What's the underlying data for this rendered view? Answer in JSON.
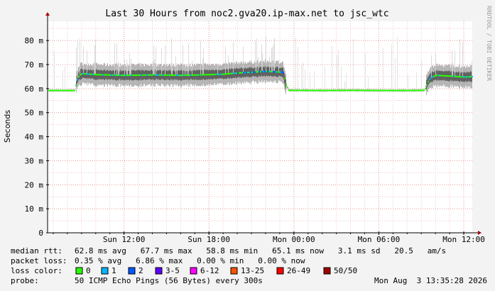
{
  "chart_data": {
    "type": "area",
    "title": "Last 30 Hours from noc2.gva20.ip-max.net to jsc_wtc",
    "ylabel": "Seconds",
    "watermark": "RRDTOOL / TOBI OETIKER",
    "ylim": [
      0,
      0.088
    ],
    "yticks": [
      {
        "value": 0,
        "label": "0"
      },
      {
        "value": 0.01,
        "label": "10 m"
      },
      {
        "value": 0.02,
        "label": "20 m"
      },
      {
        "value": 0.03,
        "label": "30 m"
      },
      {
        "value": 0.04,
        "label": "40 m"
      },
      {
        "value": 0.05,
        "label": "50 m"
      },
      {
        "value": 0.06,
        "label": "60 m"
      },
      {
        "value": 0.07,
        "label": "70 m"
      },
      {
        "value": 0.08,
        "label": "80 m"
      }
    ],
    "xlim_hours": [
      6.6,
      36.6
    ],
    "xticks": [
      {
        "hour": 12,
        "label": "Sun 12:00"
      },
      {
        "hour": 18,
        "label": "Sun 18:00"
      },
      {
        "hour": 24,
        "label": "Mon 00:00"
      },
      {
        "hour": 30,
        "label": "Mon 06:00"
      },
      {
        "hour": 36,
        "label": "Mon 12:00"
      }
    ],
    "median_series": {
      "name": "median rtt",
      "x_hours": [
        6.6,
        8.5,
        8.6,
        8.8,
        9.0,
        10,
        12,
        14,
        16,
        18,
        19,
        20,
        21,
        22,
        22.5,
        23.2,
        23.4,
        23.6,
        26,
        28,
        30,
        32,
        33.2,
        33.4,
        33.6,
        34,
        35,
        36,
        36.6
      ],
      "values": [
        0.0592,
        0.0592,
        0.063,
        0.0655,
        0.0662,
        0.0658,
        0.0655,
        0.0657,
        0.0655,
        0.0658,
        0.066,
        0.0665,
        0.0668,
        0.0672,
        0.067,
        0.0668,
        0.062,
        0.0593,
        0.0592,
        0.0593,
        0.0592,
        0.0592,
        0.0593,
        0.0625,
        0.0645,
        0.0655,
        0.0652,
        0.0648,
        0.065
      ]
    },
    "stats": {
      "median_rtt_label": "median rtt:",
      "median_rtt": "62.8 ms avg   67.7 ms max   58.8 ms min   65.1 ms now   3.1 ms sd   20.5   am/s",
      "packet_loss_label": "packet loss:",
      "packet_loss": "0.35 % avg   6.86 % max   0.00 % min   0.00 % now",
      "loss_color_label": "loss color:",
      "loss_colors": [
        {
          "label": "0",
          "color": "#26ff00"
        },
        {
          "label": "1",
          "color": "#00b8ff"
        },
        {
          "label": "2",
          "color": "#0059ff"
        },
        {
          "label": "3-5",
          "color": "#5e00ff"
        },
        {
          "label": "6-12",
          "color": "#ff00ff"
        },
        {
          "label": "13-25",
          "color": "#ff5500"
        },
        {
          "label": "26-49",
          "color": "#ff0000"
        },
        {
          "label": "50/50",
          "color": "#a10000"
        }
      ],
      "probe_label": "probe:",
      "probe": "50 ICMP Echo Pings (56 Bytes) every 300s",
      "timestamp": "Mon Aug  3 13:35:28 2026"
    }
  }
}
